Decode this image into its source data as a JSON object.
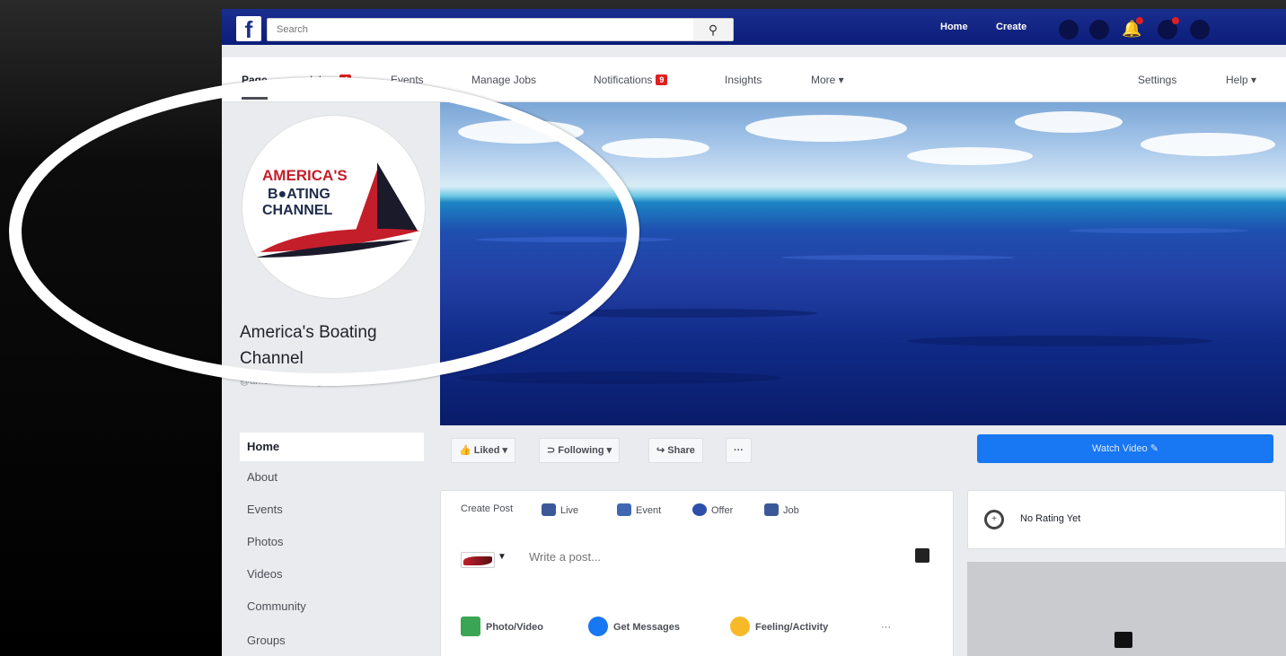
{
  "topbar": {
    "logo": "f",
    "search_placeholder": "Search",
    "nav": [
      "Home",
      "Create"
    ]
  },
  "page_tabs": {
    "active": "Page",
    "items": [
      {
        "label": "Page"
      },
      {
        "label": "Inbox",
        "badge": "4"
      },
      {
        "label": "Events"
      },
      {
        "label": "Manage Jobs"
      },
      {
        "label": "Notifications",
        "badge": "9"
      },
      {
        "label": "Insights"
      },
      {
        "label": "More ▾"
      }
    ],
    "right": [
      "Settings",
      "Help ▾"
    ]
  },
  "page": {
    "logo_lines": [
      "AMERICA'S",
      "B●ATING",
      "CHANNEL"
    ],
    "name": "America's Boating Channel",
    "handle": "@americasboatingchannel"
  },
  "sidebar": {
    "items": [
      "Home",
      "About",
      "Events",
      "Photos",
      "Videos",
      "Community",
      "Groups"
    ],
    "active": "Home"
  },
  "actions": {
    "liked": "Liked ▾",
    "following": "Following ▾",
    "share": "Share",
    "more": "···",
    "watch_video": "Watch Video ✎"
  },
  "composer": {
    "options": [
      "Create Post",
      "Live",
      "Event",
      "Offer",
      "Job"
    ],
    "placeholder": "Write a post...",
    "bottom": [
      "Photo/Video",
      "Get Messages",
      "Feeling/Activity",
      "···"
    ]
  },
  "right_col": {
    "rating": "No Rating Yet"
  },
  "colors": {
    "fb_blue": "#1c2f8a",
    "accent_blue": "#1877f2",
    "badge_red": "#e02020"
  }
}
